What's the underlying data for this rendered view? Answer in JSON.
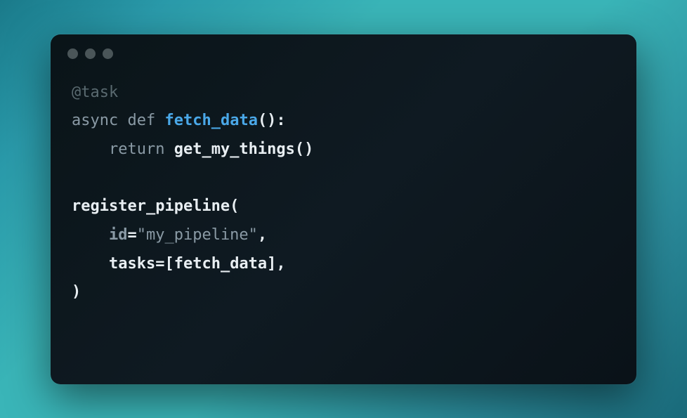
{
  "code": {
    "line1": {
      "decorator": "@task"
    },
    "line2": {
      "async": "async",
      "def": "def",
      "funcName": "fetch_data",
      "parens": "():"
    },
    "line3": {
      "indent": "    ",
      "return": "return",
      "call": "get_my_things()"
    },
    "line4": {
      "func": "register_pipeline",
      "open": "("
    },
    "line5": {
      "indent": "    ",
      "param": "id",
      "eq": "=",
      "value": "\"my_pipeline\"",
      "comma": ","
    },
    "line6": {
      "indent": "    ",
      "param": "tasks",
      "eq": "=",
      "open": "[",
      "value": "fetch_data",
      "close": "]",
      "comma": ","
    },
    "line7": {
      "close": ")"
    }
  }
}
